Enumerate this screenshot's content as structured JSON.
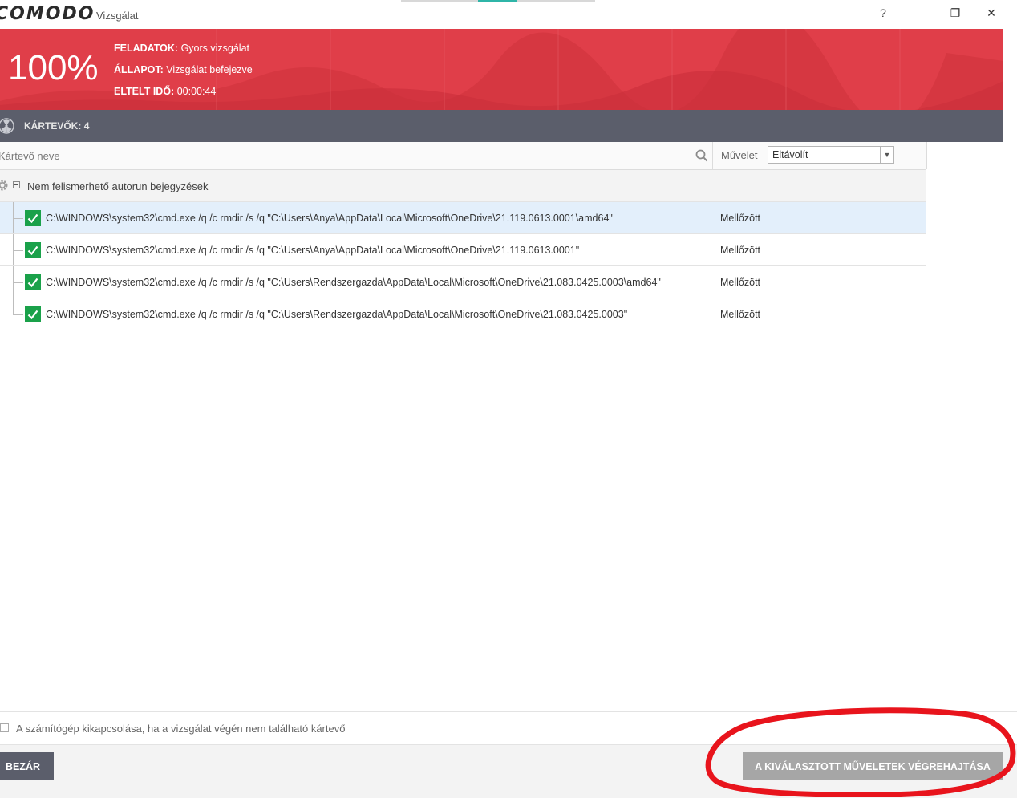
{
  "app": {
    "logo": "COMODO",
    "window_title": "Vizsgálat",
    "controls": {
      "help": "?",
      "minimize": "–",
      "restore": "❐",
      "close": "✕"
    }
  },
  "header": {
    "percent": "100%",
    "tasks_label": "FELADATOK:",
    "tasks_value": " Gyors vizsgálat",
    "status_label": "ÁLLAPOT:",
    "status_value": " Vizsgálat befejezve",
    "elapsed_label": "ELTELT IDŐ:",
    "elapsed_value": " 00:00:44",
    "color": "#e03e49"
  },
  "threats": {
    "label": "KÁRTEVŐK:",
    "count": "4"
  },
  "columns": {
    "name": "Kártevő neve",
    "action_label": "Művelet",
    "action_selected": "Eltávolít"
  },
  "group": {
    "label": "Nem felismerhető autorun bejegyzések"
  },
  "rows": [
    {
      "path": "C:\\WINDOWS\\system32\\cmd.exe /q /c rmdir /s /q \"C:\\Users\\Anya\\AppData\\Local\\Microsoft\\OneDrive\\21.119.0613.0001\\amd64\"",
      "action": "Mellőzött"
    },
    {
      "path": "C:\\WINDOWS\\system32\\cmd.exe /q /c rmdir /s /q \"C:\\Users\\Anya\\AppData\\Local\\Microsoft\\OneDrive\\21.119.0613.0001\"",
      "action": "Mellőzött"
    },
    {
      "path": "C:\\WINDOWS\\system32\\cmd.exe /q /c rmdir /s /q \"C:\\Users\\Rendszergazda\\AppData\\Local\\Microsoft\\OneDrive\\21.083.0425.0003\\amd64\"",
      "action": "Mellőzött"
    },
    {
      "path": "C:\\WINDOWS\\system32\\cmd.exe /q /c rmdir /s /q \"C:\\Users\\Rendszergazda\\AppData\\Local\\Microsoft\\OneDrive\\21.083.0425.0003\"",
      "action": "Mellőzött"
    }
  ],
  "footer": {
    "shutdown_label": "A számítógép kikapcsolása, ha a vizsgálat végén nem található kártevő",
    "close_button": "BEZÁR",
    "execute_button": "A KIVÁLASZTOTT MŰVELETEK VÉGREHAJTÁSA"
  },
  "icons": [
    "gear-icon",
    "radiation-icon",
    "search-icon",
    "checkmark-icon",
    "collapse-icon"
  ],
  "annotation_color": "#e8141c"
}
